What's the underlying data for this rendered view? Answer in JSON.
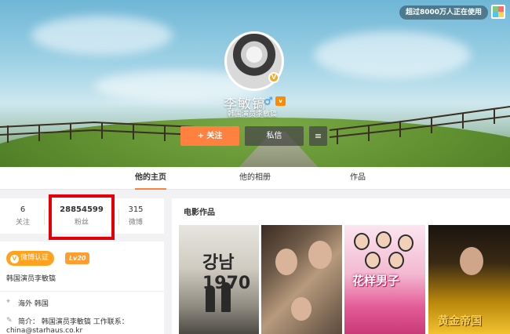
{
  "cover": {
    "top_badge": "超过8000万人正在使用",
    "name": "李敏镐",
    "bio": "韩国演员李敏镐",
    "follow_label": "+ 关注",
    "message_label": "私信",
    "more_label": "≡"
  },
  "tabs": [
    {
      "label": "他的主页",
      "active": true
    },
    {
      "label": "他的相册",
      "active": false
    },
    {
      "label": "作品",
      "active": false
    }
  ],
  "stats": {
    "follow": {
      "value": "6",
      "label": "关注"
    },
    "fans": {
      "value": "28854599",
      "label": "粉丝"
    },
    "posts": {
      "value": "315",
      "label": "微博"
    }
  },
  "profile": {
    "verify_label": "微博认证",
    "level": "Lv20",
    "verify_text": "韩国演员李敏镐",
    "location": "海外 韩国",
    "intro": "简介： 韩国演员李敏镐 工作联系：",
    "intro_contact": "china@starhaus.co.kr"
  },
  "movies": {
    "section_title": "电影作品",
    "posters": [
      {
        "title": "강남 1970"
      },
      {
        "title": ""
      },
      {
        "title": "花样男子"
      },
      {
        "title": "黄金帝国"
      }
    ]
  },
  "colors": {
    "accent": "#ff8140",
    "highlight": "#e3000b",
    "verify": "#ffa21f"
  }
}
